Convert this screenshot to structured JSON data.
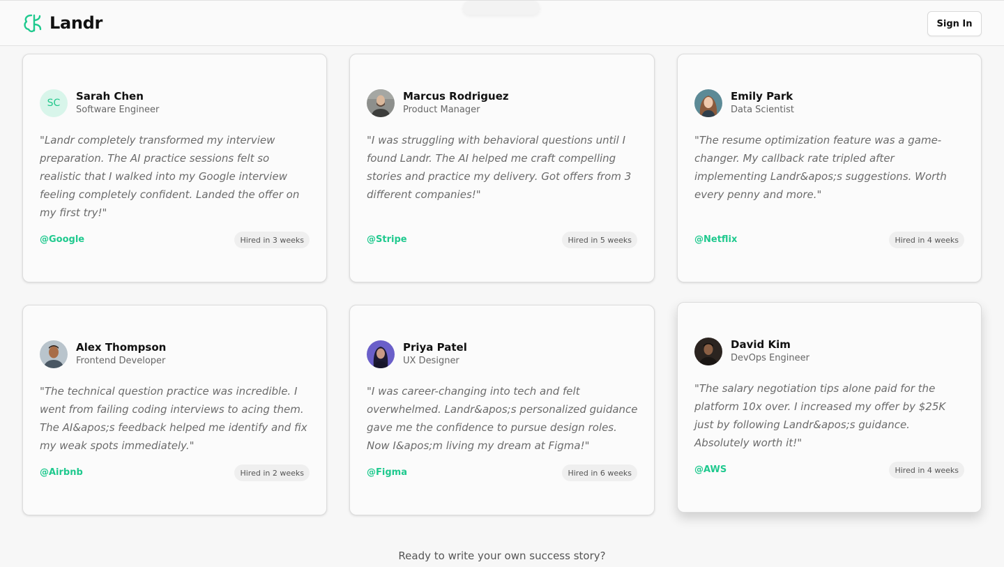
{
  "header": {
    "brand": "Landr",
    "signin_label": "Sign In"
  },
  "testimonials": [
    {
      "name": "Sarah Chen",
      "role": "Software Engineer",
      "initials": "SC",
      "quote": "\"Landr completely transformed my interview preparation. The AI practice sessions felt so realistic that I walked into my Google interview feeling completely confident. Landed the offer on my first try!\"",
      "company": "@Google",
      "hired": "Hired in 3 weeks"
    },
    {
      "name": "Marcus Rodriguez",
      "role": "Product Manager",
      "quote": "\"I was struggling with behavioral questions until I found Landr. The AI helped me craft compelling stories and practice my delivery. Got offers from 3 different companies!\"",
      "company": "@Stripe",
      "hired": "Hired in 5 weeks"
    },
    {
      "name": "Emily Park",
      "role": "Data Scientist",
      "quote": "\"The resume optimization feature was a game-changer. My callback rate tripled after implementing Landr&apos;s suggestions. Worth every penny and more.\"",
      "company": "@Netflix",
      "hired": "Hired in 4 weeks"
    },
    {
      "name": "Alex Thompson",
      "role": "Frontend Developer",
      "quote": "\"The technical question practice was incredible. I went from failing coding interviews to acing them. The AI&apos;s feedback helped me identify and fix my weak spots immediately.\"",
      "company": "@Airbnb",
      "hired": "Hired in 2 weeks"
    },
    {
      "name": "Priya Patel",
      "role": "UX Designer",
      "quote": "\"I was career-changing into tech and felt overwhelmed. Landr&apos;s personalized guidance gave me the confidence to pursue design roles. Now I&apos;m living my dream at Figma!\"",
      "company": "@Figma",
      "hired": "Hired in 6 weeks"
    },
    {
      "name": "David Kim",
      "role": "DevOps Engineer",
      "quote": "\"The salary negotiation tips alone paid for the platform 10x over. I increased my offer by $25K just by following Landr&apos;s guidance. Absolutely worth it!\"",
      "company": "@AWS",
      "hired": "Hired in 4 weeks"
    }
  ],
  "cta": {
    "text": "Ready to write your own success story?"
  },
  "colors": {
    "accent": "#1fc98e"
  }
}
